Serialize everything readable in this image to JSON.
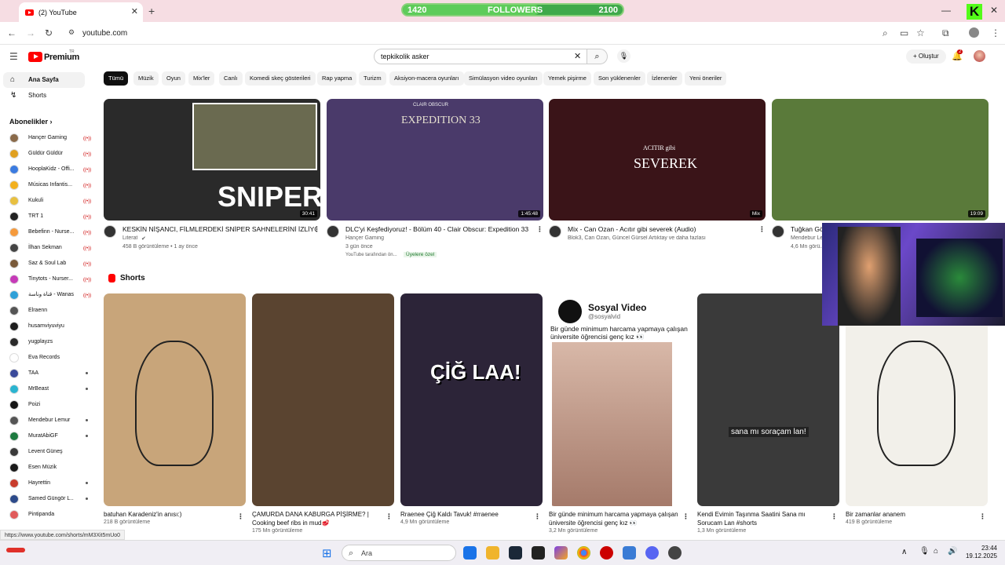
{
  "browser": {
    "tab_title": "(2) YouTube",
    "address": "youtube.com",
    "status_url": "https://www.youtube.com/shorts/mM3Xit5mUo0"
  },
  "overlay": {
    "followers_label": "FOLLOWERS",
    "followers_current": "1420",
    "followers_goal": "2100",
    "followers_progress": 0.62
  },
  "header": {
    "logo": "Premium",
    "logo_region": "TR",
    "search_value": "tepkikolik asker",
    "create_label": "Oluştur",
    "notif_count": "2"
  },
  "sidebar": {
    "home": "Ana Sayfa",
    "shorts": "Shorts",
    "subs_title": "Abonelikler",
    "subs": [
      {
        "name": "Hançer Gaming",
        "mark": "live",
        "color": "#8a6a4a"
      },
      {
        "name": "Güldür Güldür",
        "mark": "live",
        "color": "#e0a020"
      },
      {
        "name": "HooplaKidz - Offi...",
        "mark": "live",
        "color": "#3b7be0"
      },
      {
        "name": "Músicas Infantis...",
        "mark": "live",
        "color": "#f2b01e"
      },
      {
        "name": "Kukuli",
        "mark": "live",
        "color": "#e8c040"
      },
      {
        "name": "TRT 1",
        "mark": "live",
        "color": "#222222"
      },
      {
        "name": "Bebefinn - Nurse...",
        "mark": "live",
        "color": "#f59a3c"
      },
      {
        "name": "İlhan Sekman",
        "mark": "live",
        "color": "#444444"
      },
      {
        "name": "Saz & Soul Lab",
        "mark": "live",
        "color": "#7a5a3a"
      },
      {
        "name": "Tinytots - Nurser...",
        "mark": "live",
        "color": "#c63ab8"
      },
      {
        "name": "قناة وناسة - Wanasa...",
        "mark": "live",
        "color": "#2fa0d8"
      },
      {
        "name": "Elraenn",
        "mark": "",
        "color": "#555555"
      },
      {
        "name": "husamviyuviyu",
        "mark": "",
        "color": "#1e1e1e"
      },
      {
        "name": "yugplayzs",
        "mark": "",
        "color": "#2a2a2a"
      },
      {
        "name": "Eva Records",
        "mark": "",
        "color": "#ffffff"
      },
      {
        "name": "TAA",
        "mark": "dot",
        "color": "#3a4a9a"
      },
      {
        "name": "MrBeast",
        "mark": "dot",
        "color": "#2ab4d0"
      },
      {
        "name": "Poizi",
        "mark": "",
        "color": "#151515"
      },
      {
        "name": "Mendebur Lemur",
        "mark": "dot",
        "color": "#555555"
      },
      {
        "name": "MuratAbiGF",
        "mark": "dot",
        "color": "#1d7a40"
      },
      {
        "name": "Levent Güneş",
        "mark": "",
        "color": "#3a3a3a"
      },
      {
        "name": "Esen Müzik",
        "mark": "",
        "color": "#1a1a1a"
      },
      {
        "name": "Hayrettin",
        "mark": "dot",
        "color": "#c83c2c"
      },
      {
        "name": "Samed Güngör L...",
        "mark": "dot",
        "color": "#2c4a8a"
      },
      {
        "name": "Pintipanda",
        "mark": "",
        "color": "#e05a5a"
      }
    ]
  },
  "chips": [
    "Tümü",
    "Müzik",
    "Oyun",
    "Mix'ler",
    "Canlı",
    "Komedi skeç gösterileri",
    "Rap yapma",
    "Turizm",
    "Aksiyon-macera oyunları",
    "Simülasyon video oyunları",
    "Yemek pişirme",
    "Son yüklenenler",
    "İzlenenler",
    "Yeni öneriler"
  ],
  "videos": [
    {
      "title": "KESKİN NİŞANCI, FİLMLERDEKİ SNİPER SAHNELERİNİ İZLİYOR!",
      "channel": "Literat",
      "verified": "✔",
      "meta": "458 B görüntüleme • 1 ay önce",
      "extra": "",
      "badge": "",
      "duration": "30:41",
      "thumb_text": "SNIPER",
      "bg": "#2a2a2a"
    },
    {
      "title": "DLC'yi Keşfediyoruz! - Bölüm 40 - Clair Obscur: Expedition 33",
      "channel": "Hançer Gaming",
      "verified": "",
      "meta": "3 gün önce",
      "extra": "YouTube tarafından ön...",
      "badge": "Üyelere özel",
      "duration": "1:45:48",
      "thumb_text": "EXPEDITION 33",
      "thumb_small": "CLAIR OBSCUR",
      "bg": "#4a3a6a"
    },
    {
      "title": "Mix - Can Ozan - Acıtır gibi severek (Audio)",
      "channel": "Blok3, Can Ozan, Güncel Gürsel Artıktay ve daha fazlası",
      "verified": "",
      "meta": "",
      "extra": "",
      "badge": "",
      "duration": "Mix",
      "thumb_text": "SEVEREK",
      "thumb_small": "ACITIR gibi",
      "bg": "#3a1418"
    },
    {
      "title": "Tuğkan Gö...",
      "channel": "Mendebur Le...",
      "verified": "",
      "meta": "4,6 Mn görü...",
      "extra": "",
      "badge": "",
      "duration": "19:09",
      "thumb_text": "",
      "bg": "#5a7a3a"
    }
  ],
  "shorts_title": "Shorts",
  "shorts": [
    {
      "title": "batuhan Karadeniz'in anısı:)",
      "views": "218 B görüntüleme",
      "overlay": "",
      "bg": "#c8a57a"
    },
    {
      "title": "ÇAMURDA DANA KABURGA PİŞİRME? | Cooking beef ribs in mud🥩",
      "views": "175 Mn görüntüleme",
      "overlay": "",
      "bg": "#5a4430"
    },
    {
      "title": "Rraenee Çiğ Kaldı Tavuk!  #rraenee",
      "views": "4,9 Mn görüntüleme",
      "overlay": "ÇİĞ LAA!",
      "bg": "#2c2438"
    },
    {
      "title": "Bir günde minimum harcama yapmaya çalışan üniversite öğrencisi genç kız 👀",
      "views": "3,2 Mn görüntüleme",
      "overlay": "",
      "card_title": "Sosyal Video",
      "card_handle": "@sosyalvid",
      "card_text": "Bir günde minimum harcama yapmaya çalışan üniversite öğrencisi genç kız 👀",
      "bg": "#ffffff"
    },
    {
      "title": "Kendi Evimin Taşınma Saatini Sana mı Sorucam Lan #shorts",
      "views": "1,3 Mn görüntüleme",
      "overlay": "sana mı soraçam lan!",
      "bg": "#3a3a3a"
    },
    {
      "title": "Bir zamanlar ananem",
      "views": "419 B görüntüleme",
      "overlay": "",
      "bg": "#f2f0ea"
    }
  ],
  "taskbar": {
    "search_placeholder": "Ara",
    "time": "23:44",
    "date": "19.12.2025"
  }
}
